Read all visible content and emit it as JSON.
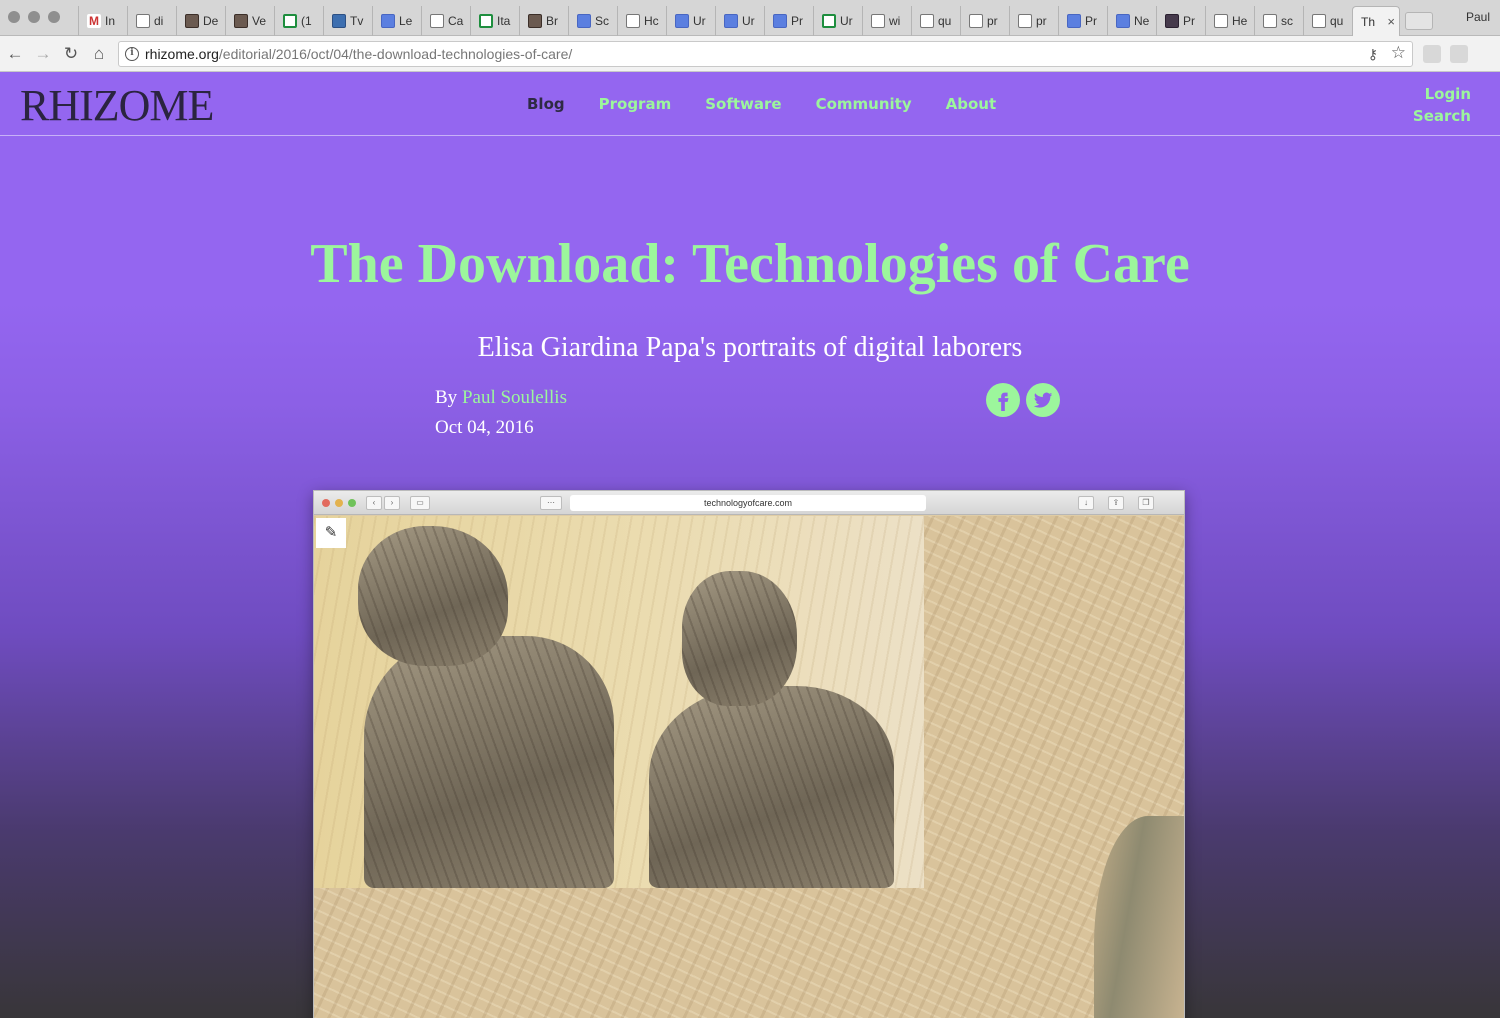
{
  "browser": {
    "tabs": [
      {
        "title": "In",
        "fav": "mail"
      },
      {
        "title": "di",
        "fav": "doc"
      },
      {
        "title": "De",
        "fav": "photo"
      },
      {
        "title": "Ve",
        "fav": "photo"
      },
      {
        "title": "(1",
        "fav": "green"
      },
      {
        "title": "Tv",
        "fav": "bird"
      },
      {
        "title": "Le",
        "fav": "blue"
      },
      {
        "title": "Ca",
        "fav": "doc"
      },
      {
        "title": "Ita",
        "fav": "green"
      },
      {
        "title": "Br",
        "fav": "photo"
      },
      {
        "title": "Sc",
        "fav": "blue"
      },
      {
        "title": "Hc",
        "fav": "doc"
      },
      {
        "title": "Ur",
        "fav": "blue"
      },
      {
        "title": "Ur",
        "fav": "blue"
      },
      {
        "title": "Pr",
        "fav": "blue"
      },
      {
        "title": "Ur",
        "fav": "green"
      },
      {
        "title": "wi",
        "fav": "doc"
      },
      {
        "title": "qu",
        "fav": "doc"
      },
      {
        "title": "pr",
        "fav": "doc"
      },
      {
        "title": "pr",
        "fav": "doc"
      },
      {
        "title": "Pr",
        "fav": "blue"
      },
      {
        "title": "Ne",
        "fav": "blue"
      },
      {
        "title": "Pr",
        "fav": "dark"
      },
      {
        "title": "He",
        "fav": "doc"
      },
      {
        "title": "sc",
        "fav": "doc"
      },
      {
        "title": "qu",
        "fav": "doc"
      }
    ],
    "active_tab": {
      "title": "Th",
      "close": "×"
    },
    "profile_name": "Paul",
    "url_host": "rhizome.org",
    "url_path": "/editorial/2016/oct/04/the-download-technologies-of-care/",
    "icons": {
      "back": "←",
      "forward": "→",
      "reload": "↻",
      "home": "⌂",
      "info": "i",
      "key": "⚷",
      "star": "☆"
    }
  },
  "site": {
    "logo": "RHIZOME",
    "nav": [
      {
        "label": "Blog",
        "current": true
      },
      {
        "label": "Program",
        "current": false
      },
      {
        "label": "Software",
        "current": false
      },
      {
        "label": "Community",
        "current": false
      },
      {
        "label": "About",
        "current": false
      }
    ],
    "login": "Login",
    "search": "Search",
    "accent_color": "#9cf69c",
    "background_color": "#9466f0"
  },
  "article": {
    "title": "The Download: Technologies of Care",
    "subtitle": "Elisa Giardina Papa's portraits of digital laborers",
    "by": "By",
    "author": "Paul Soulellis",
    "date": "Oct 04, 2016",
    "social": [
      "facebook-icon",
      "twitter-icon"
    ]
  },
  "screenshot": {
    "url": "technologyofcare.com"
  }
}
